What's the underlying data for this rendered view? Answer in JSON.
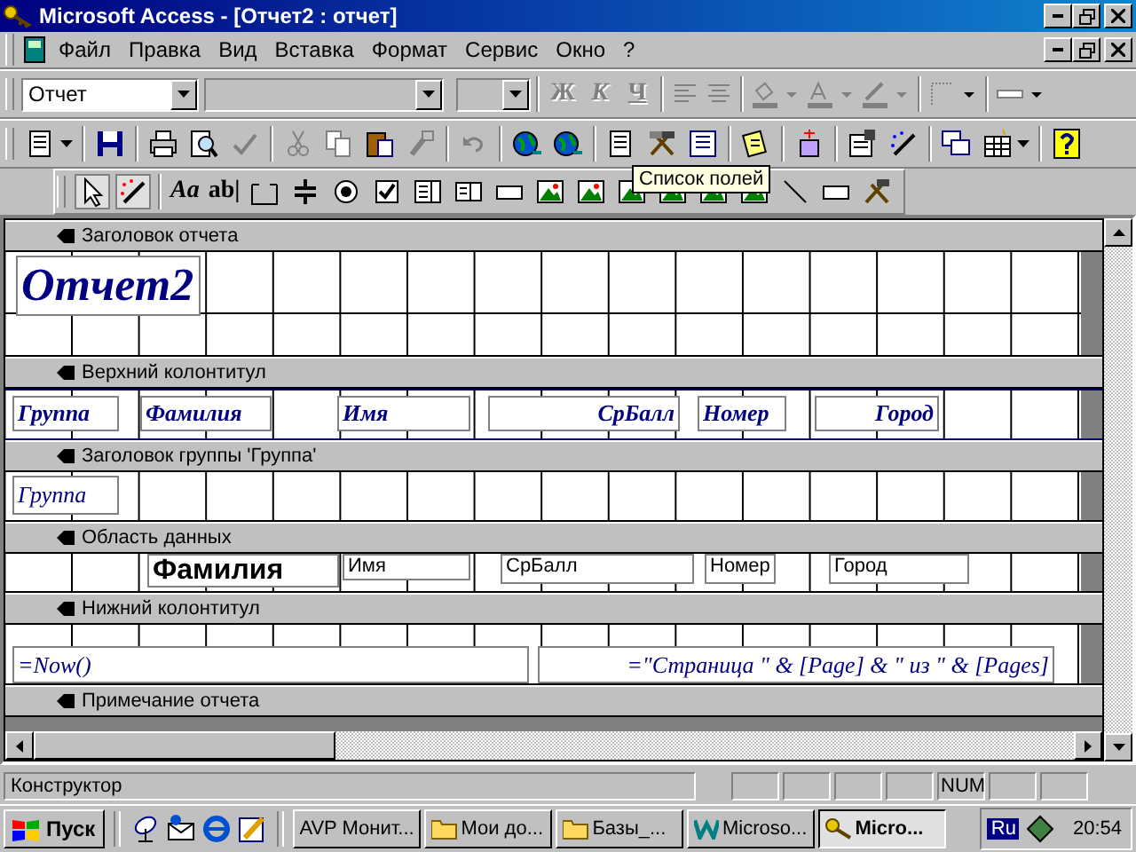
{
  "window": {
    "title": "Microsoft Access - [Отчет2 : отчет]"
  },
  "menu": [
    "Файл",
    "Правка",
    "Вид",
    "Вставка",
    "Формат",
    "Сервис",
    "Окно",
    "?"
  ],
  "format_toolbar": {
    "object": "Отчет",
    "bold": "Ж",
    "italic": "К",
    "underline": "Ч"
  },
  "toolbox": {
    "label_tool": "Aa",
    "textbox_tool": "ab|"
  },
  "tooltip": "Список полей",
  "sections": [
    {
      "title": "Заголовок отчета",
      "controls": [
        {
          "kind": "title",
          "text": "Отчет2"
        }
      ]
    },
    {
      "title": "Верхний колонтитул",
      "controls": [
        {
          "kind": "heading",
          "text": "Группа"
        },
        {
          "kind": "heading",
          "text": "Фамилия"
        },
        {
          "kind": "heading",
          "text": "Имя"
        },
        {
          "kind": "heading",
          "text": "СрБалл"
        },
        {
          "kind": "heading",
          "text": "Номер"
        },
        {
          "kind": "heading",
          "text": "Город"
        }
      ]
    },
    {
      "title": "Заголовок группы 'Группа'",
      "controls": [
        {
          "kind": "italic",
          "text": "Группа"
        }
      ]
    },
    {
      "title": "Область данных",
      "controls": [
        {
          "kind": "bold_field",
          "text": "Фамилия"
        },
        {
          "kind": "field",
          "text": "Имя"
        },
        {
          "kind": "field",
          "text": "СрБалл"
        },
        {
          "kind": "field",
          "text": "Номер"
        },
        {
          "kind": "field",
          "text": "Город"
        }
      ]
    },
    {
      "title": "Нижний колонтитул",
      "controls": [
        {
          "kind": "italic",
          "text": "=Now()"
        },
        {
          "kind": "italic",
          "text": "=\"Страница \" & [Page] & \" из \" & [Pages]"
        }
      ]
    },
    {
      "title": "Примечание отчета"
    }
  ],
  "status_bar": {
    "mode": "Конструктор",
    "num": "NUM"
  },
  "taskbar": {
    "start": "Пуск",
    "tasks": [
      {
        "label": "AVP Монит...",
        "selected": false
      },
      {
        "label": "Мои до...",
        "selected": false
      },
      {
        "label": "Базы_...",
        "selected": false
      },
      {
        "label": "Microso...",
        "selected": false
      },
      {
        "label": "Micro...",
        "selected": true
      }
    ],
    "language": "Ru",
    "clock": "20:54"
  }
}
